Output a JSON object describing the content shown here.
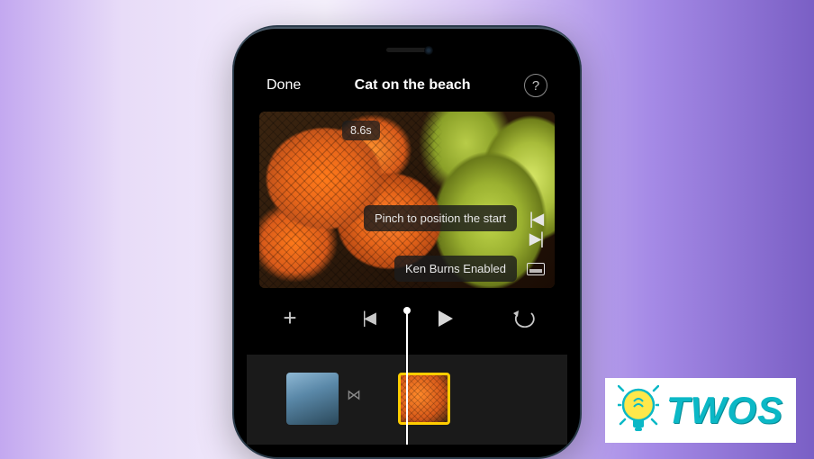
{
  "topbar": {
    "done_label": "Done",
    "title": "Cat on the beach",
    "help_label": "?"
  },
  "preview": {
    "duration_text": "8.6s",
    "pinch_tip": "Pinch to position the start",
    "ken_burns_tip": "Ken Burns Enabled"
  },
  "controls": {
    "add_label": "+",
    "prev_label": "previous",
    "play_label": "play",
    "undo_label": "undo"
  },
  "timeline": {
    "selected_clip_index": 1
  },
  "branding": {
    "logo_text": "TWOS"
  }
}
